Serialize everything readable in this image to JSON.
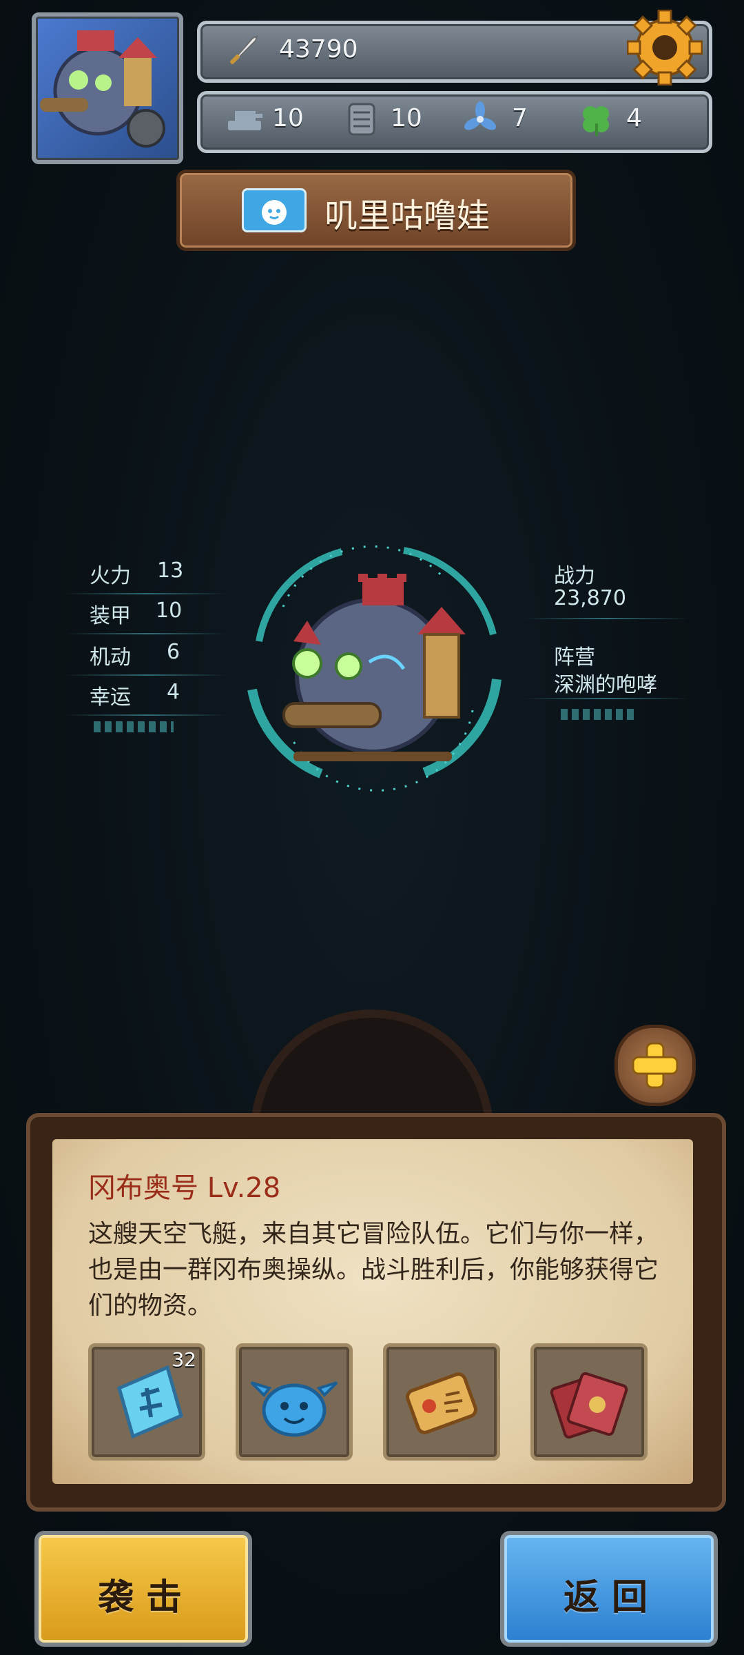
{
  "header": {
    "power": "43790",
    "resources": [
      {
        "icon": "cannon-icon",
        "value": "10"
      },
      {
        "icon": "armor-plate-icon",
        "value": "10"
      },
      {
        "icon": "propeller-icon",
        "value": "7"
      },
      {
        "icon": "clover-icon",
        "value": "4"
      }
    ]
  },
  "player": {
    "name": "叽里咕噜娃"
  },
  "stats_left": [
    {
      "label": "火力",
      "value": "13"
    },
    {
      "label": "装甲",
      "value": "10"
    },
    {
      "label": "机动",
      "value": "6"
    },
    {
      "label": "幸运",
      "value": "4"
    }
  ],
  "stats_right": {
    "power_label": "战力",
    "power_value": "23,870",
    "faction_label": "阵营",
    "faction_value": "深渊的咆哮"
  },
  "card": {
    "title": "冈布奥号 Lv.28",
    "description": "这艘天空飞艇，来自其它冒险队伍。它们与你一样，也是由一群冈布奥操纵。战斗胜利后，你能够获得它们的物资。",
    "items": [
      {
        "icon": "rune-stone-icon",
        "count": "32"
      },
      {
        "icon": "blue-slime-icon",
        "count": ""
      },
      {
        "icon": "scroll-icon",
        "count": ""
      },
      {
        "icon": "cards-icon",
        "count": ""
      }
    ]
  },
  "buttons": {
    "attack": "袭击",
    "back": "返回"
  },
  "colors": {
    "accent_cyan": "#3fb7b3",
    "attack_gold": "#e8b43a",
    "back_blue": "#3f93de",
    "title_red": "#9a2c1a"
  }
}
